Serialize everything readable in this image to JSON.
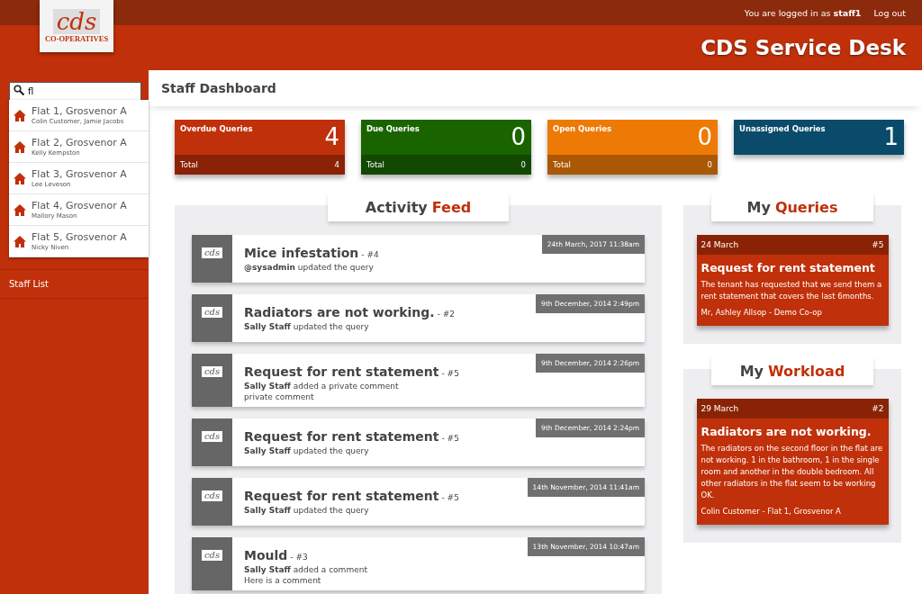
{
  "header": {
    "logo": {
      "mark": "cds",
      "caption": "CO-OPERATIVES"
    },
    "login_text": "You are logged in as",
    "user": "staff1",
    "logout": "Log out",
    "title": "CDS Service Desk"
  },
  "sidebar": {
    "search": {
      "value": "fl"
    },
    "suggestions": [
      {
        "title": "Flat 1, Grosvenor A",
        "subtitle": "Colin Customer, Jamie Jacobs"
      },
      {
        "title": "Flat 2, Grosvenor A",
        "subtitle": "Kelly Kempston"
      },
      {
        "title": "Flat 3, Grosvenor A",
        "subtitle": "Lee Leveson"
      },
      {
        "title": "Flat 4, Grosvenor A",
        "subtitle": "Mallory Mason"
      },
      {
        "title": "Flat 5, Grosvenor A",
        "subtitle": "Nicky Niven"
      }
    ],
    "items": [
      "Staff List"
    ]
  },
  "page_title": "Staff Dashboard",
  "stats": [
    {
      "label": "Overdue Queries",
      "count": "4",
      "color": "#c0300a",
      "total_label": "Total",
      "total": "4"
    },
    {
      "label": "Due Queries",
      "count": "0",
      "color": "#1a6400",
      "total_label": "Total",
      "total": "0"
    },
    {
      "label": "Open Queries",
      "count": "0",
      "color": "#ec7a05",
      "total_label": "Total",
      "total": "0"
    },
    {
      "label": "Unassigned Queries",
      "count": "1",
      "color": "#0a4a6a"
    }
  ],
  "activity_feed": {
    "heading": {
      "first": "Activity",
      "accent": "Feed"
    },
    "items": [
      {
        "avatar": "cds",
        "title": "Mice infestation",
        "ref": "- #4",
        "text": "**@sysadmin** updated the query",
        "time": "24th March, 2017 11:38am"
      },
      {
        "avatar": "cds",
        "title": "Radiators are not working.",
        "ref": "- #2",
        "text": "**Sally Staff** updated the query",
        "time": "9th December, 2014 2:49pm"
      },
      {
        "avatar": "cds",
        "title": "Request for rent statement",
        "ref": "- #5",
        "text": "**Sally Staff** added a private comment",
        "comment": "private comment",
        "time": "9th December, 2014 2:26pm"
      },
      {
        "avatar": "cds",
        "title": "Request for rent statement",
        "ref": "- #5",
        "text": "**Sally Staff** updated the query",
        "time": "9th December, 2014 2:24pm"
      },
      {
        "avatar": "cds",
        "title": "Request for rent statement",
        "ref": "- #5",
        "text": "**Sally Staff** updated the query",
        "time": "14th November, 2014 11:41am"
      },
      {
        "avatar": "cds",
        "title": "Mould",
        "ref": "- #3",
        "text": "**Sally Staff** added a comment",
        "comment": "Here is a comment",
        "time": "13th November, 2014 10:47am"
      }
    ]
  },
  "side_panels": [
    {
      "heading": {
        "first": "My",
        "accent": "Queries"
      },
      "card": {
        "date": "24 March",
        "ref": "#5",
        "title": "Request for rent statement",
        "body": "The tenant has requested that we send them a rent statement that covers the last 6months.",
        "footer": "Mr, Ashley Allsop - Demo Co-op"
      }
    },
    {
      "heading": {
        "first": "My",
        "accent": "Workload"
      },
      "card": {
        "date": "29 March",
        "ref": "#2",
        "title": "Radiators are not working.",
        "body": "The radiators on the second floor in the flat are not working. 1 in the bathroom, 1 in the single room and another in the double bedroom. All other radiators in the flat seem to be working OK.",
        "footer": "Colin Customer - Flat 1, Grosvenor A"
      }
    }
  ]
}
